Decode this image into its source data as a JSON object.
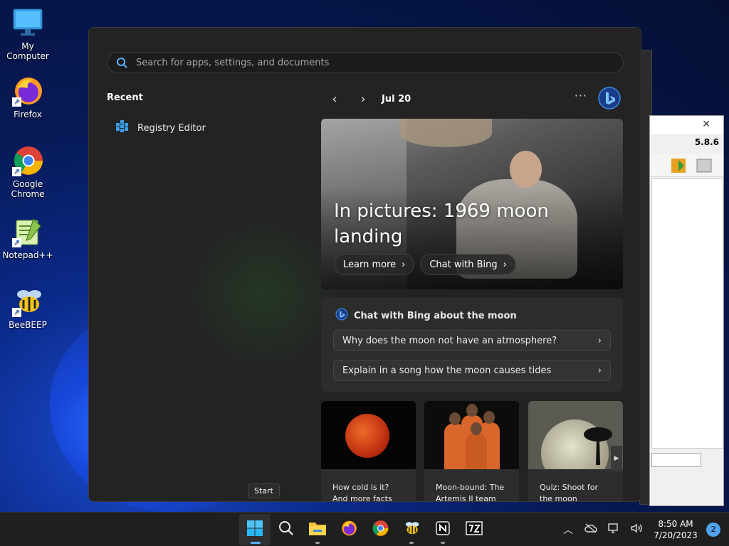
{
  "desktop": {
    "icons": [
      {
        "label": "My Computer"
      },
      {
        "label": "Firefox"
      },
      {
        "label": "Google Chrome"
      },
      {
        "label": "Notepad++"
      },
      {
        "label": "BeeBEEP"
      }
    ]
  },
  "background_app": {
    "version": "5.8.6"
  },
  "start_menu": {
    "search_placeholder": "Search for apps, settings, and documents",
    "recent_title": "Recent",
    "recent_items": [
      {
        "label": "Registry Editor"
      }
    ],
    "nav": {
      "date": "Jul 20",
      "more": "···"
    },
    "hero": {
      "title": "In pictures: 1969 moon landing",
      "buttons": [
        {
          "label": "Learn more"
        },
        {
          "label": "Chat with Bing"
        }
      ]
    },
    "chat": {
      "title": "Chat with Bing about the moon",
      "questions": [
        {
          "label": "Why does the moon not have an atmosphere?"
        },
        {
          "label": "Explain in a song how the moon causes tides"
        }
      ]
    },
    "cards": [
      {
        "caption": "How cold is it? And more facts"
      },
      {
        "caption": "Moon-bound: The Artemis II team"
      },
      {
        "caption": "Quiz: Shoot for the moon"
      }
    ],
    "tooltip": "Start"
  },
  "taskbar": {
    "time": "8:50 AM",
    "date": "7/20/2023",
    "notification_count": "2",
    "accent": "#5ab0ff"
  }
}
